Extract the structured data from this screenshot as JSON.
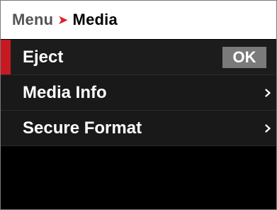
{
  "header": {
    "root": "Menu",
    "separator_icon": "chevron-right-red-icon",
    "current": "Media"
  },
  "menu": {
    "items": [
      {
        "label": "Eject",
        "action_label": "OK",
        "selected": true
      },
      {
        "label": "Media Info",
        "trailing_icon": "chevron-right-icon"
      },
      {
        "label": "Secure Format",
        "trailing_icon": "chevron-right-icon"
      }
    ]
  },
  "colors": {
    "accent_red": "#c61a22",
    "header_bg": "#ffffff",
    "row_bg": "#191919",
    "ok_badge_bg": "#7a7a7a"
  }
}
